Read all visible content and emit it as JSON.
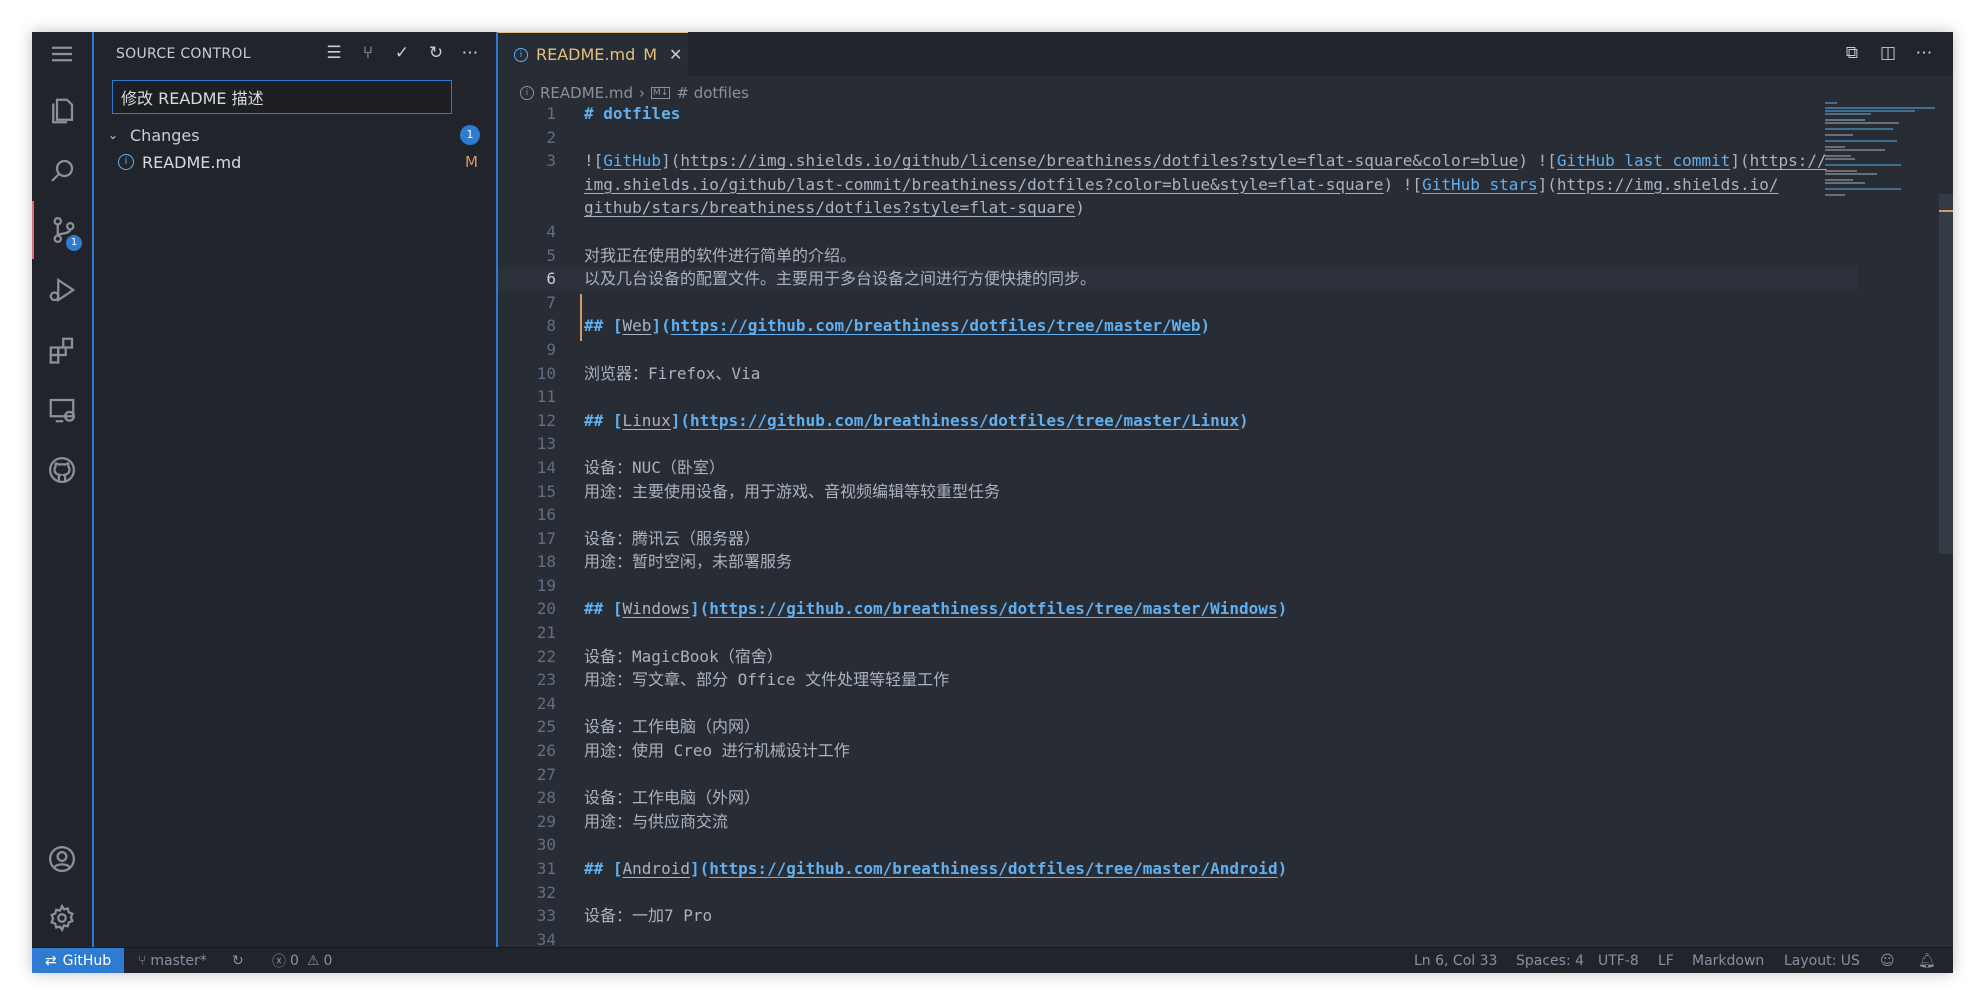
{
  "sidebar": {
    "title": "SOURCE CONTROL",
    "commit_message": "修改 README 描述",
    "changes_label": "Changes",
    "changes_count": "1",
    "files": [
      {
        "name": "README.md",
        "status": "M"
      }
    ]
  },
  "activity": {
    "scm_badge": "1"
  },
  "tab": {
    "name": "README.md",
    "status": "M"
  },
  "breadcrumb": {
    "file": "README.md",
    "symbol": "# dotfiles"
  },
  "editor": {
    "lines": [
      {
        "n": "1",
        "segs": [
          {
            "t": "# dotfiles",
            "c": "h"
          }
        ]
      },
      {
        "n": "2",
        "segs": []
      },
      {
        "n": "3",
        "segs": [
          {
            "t": "!["
          },
          {
            "t": "GitHub",
            "c": "lk"
          },
          {
            "t": "]("
          },
          {
            "t": "https://img.shields.io/github/license/breathiness/dotfiles?style=flat-square&color=blue",
            "c": "lu"
          },
          {
            "t": ") !["
          },
          {
            "t": "GitHub last commit",
            "c": "lk"
          },
          {
            "t": "]("
          },
          {
            "t": "https://",
            "c": "lu"
          }
        ]
      },
      {
        "n": "",
        "segs": [
          {
            "t": "img.shields.io/github/last-commit/breathiness/dotfiles?color=blue&style=flat-square",
            "c": "lu"
          },
          {
            "t": ") !["
          },
          {
            "t": "GitHub stars",
            "c": "lk"
          },
          {
            "t": "]("
          },
          {
            "t": "https://img.shields.io/",
            "c": "lu"
          }
        ]
      },
      {
        "n": "",
        "segs": [
          {
            "t": "github/stars/breathiness/dotfiles?style=flat-square",
            "c": "lu"
          },
          {
            "t": ")"
          }
        ]
      },
      {
        "n": "4",
        "segs": []
      },
      {
        "n": "5",
        "segs": [
          {
            "t": "对我正在使用的软件进行简单的介绍。"
          }
        ],
        "mod": true
      },
      {
        "n": "6",
        "segs": [
          {
            "t": "以及几台设备的配置文件。主要用于多台设备之间进行方便快捷的同步。"
          }
        ],
        "mod": true,
        "cur": true
      },
      {
        "n": "7",
        "segs": []
      },
      {
        "n": "8",
        "segs": [
          {
            "t": "## [",
            "c": "h"
          },
          {
            "t": "Web",
            "c": "lu"
          },
          {
            "t": "](",
            "c": "h"
          },
          {
            "t": "https://github.com/breathiness/dotfiles/tree/master/Web",
            "c": "url"
          },
          {
            "t": ")",
            "c": "h"
          }
        ]
      },
      {
        "n": "9",
        "segs": []
      },
      {
        "n": "10",
        "segs": [
          {
            "t": "浏览器：Firefox、Via"
          }
        ]
      },
      {
        "n": "11",
        "segs": []
      },
      {
        "n": "12",
        "segs": [
          {
            "t": "## [",
            "c": "h"
          },
          {
            "t": "Linux",
            "c": "lu"
          },
          {
            "t": "](",
            "c": "h"
          },
          {
            "t": "https://github.com/breathiness/dotfiles/tree/master/Linux",
            "c": "url"
          },
          {
            "t": ")",
            "c": "h"
          }
        ]
      },
      {
        "n": "13",
        "segs": []
      },
      {
        "n": "14",
        "segs": [
          {
            "t": "设备：NUC（卧室）"
          }
        ]
      },
      {
        "n": "15",
        "segs": [
          {
            "t": "用途：主要使用设备，用于游戏、音视频编辑等较重型任务"
          }
        ]
      },
      {
        "n": "16",
        "segs": []
      },
      {
        "n": "17",
        "segs": [
          {
            "t": "设备：腾讯云（服务器）"
          }
        ]
      },
      {
        "n": "18",
        "segs": [
          {
            "t": "用途：暂时空闲，未部署服务"
          }
        ]
      },
      {
        "n": "19",
        "segs": []
      },
      {
        "n": "20",
        "segs": [
          {
            "t": "## [",
            "c": "h"
          },
          {
            "t": "Windows",
            "c": "lu"
          },
          {
            "t": "](",
            "c": "h"
          },
          {
            "t": "https://github.com/breathiness/dotfiles/tree/master/Windows",
            "c": "url"
          },
          {
            "t": ")",
            "c": "h"
          }
        ]
      },
      {
        "n": "21",
        "segs": []
      },
      {
        "n": "22",
        "segs": [
          {
            "t": "设备：MagicBook（宿舍）"
          }
        ]
      },
      {
        "n": "23",
        "segs": [
          {
            "t": "用途：写文章、部分 Office 文件处理等轻量工作"
          }
        ]
      },
      {
        "n": "24",
        "segs": []
      },
      {
        "n": "25",
        "segs": [
          {
            "t": "设备：工作电脑（内网）"
          }
        ]
      },
      {
        "n": "26",
        "segs": [
          {
            "t": "用途：使用 Creo 进行机械设计工作"
          }
        ]
      },
      {
        "n": "27",
        "segs": []
      },
      {
        "n": "28",
        "segs": [
          {
            "t": "设备：工作电脑（外网）"
          }
        ]
      },
      {
        "n": "29",
        "segs": [
          {
            "t": "用途：与供应商交流"
          }
        ]
      },
      {
        "n": "30",
        "segs": []
      },
      {
        "n": "31",
        "segs": [
          {
            "t": "## [",
            "c": "h"
          },
          {
            "t": "Android",
            "c": "lu"
          },
          {
            "t": "](",
            "c": "h"
          },
          {
            "t": "https://github.com/breathiness/dotfiles/tree/master/Android",
            "c": "url"
          },
          {
            "t": ")",
            "c": "h"
          }
        ]
      },
      {
        "n": "32",
        "segs": []
      },
      {
        "n": "33",
        "segs": [
          {
            "t": "设备：一加7 Pro"
          }
        ]
      },
      {
        "n": "34",
        "segs": []
      }
    ]
  },
  "statusbar": {
    "remote": "GitHub",
    "branch": "master*",
    "errors": "0",
    "warnings": "0",
    "position": "Ln 6, Col 33",
    "spaces": "Spaces: 4",
    "encoding": "UTF-8",
    "eol": "LF",
    "language": "Markdown",
    "layout": "Layout: US"
  },
  "colors": {
    "accent": "#2f7bd1",
    "modified": "#d19a66",
    "link": "#61afef",
    "background": "#282c34",
    "sidebar": "#21252b"
  }
}
